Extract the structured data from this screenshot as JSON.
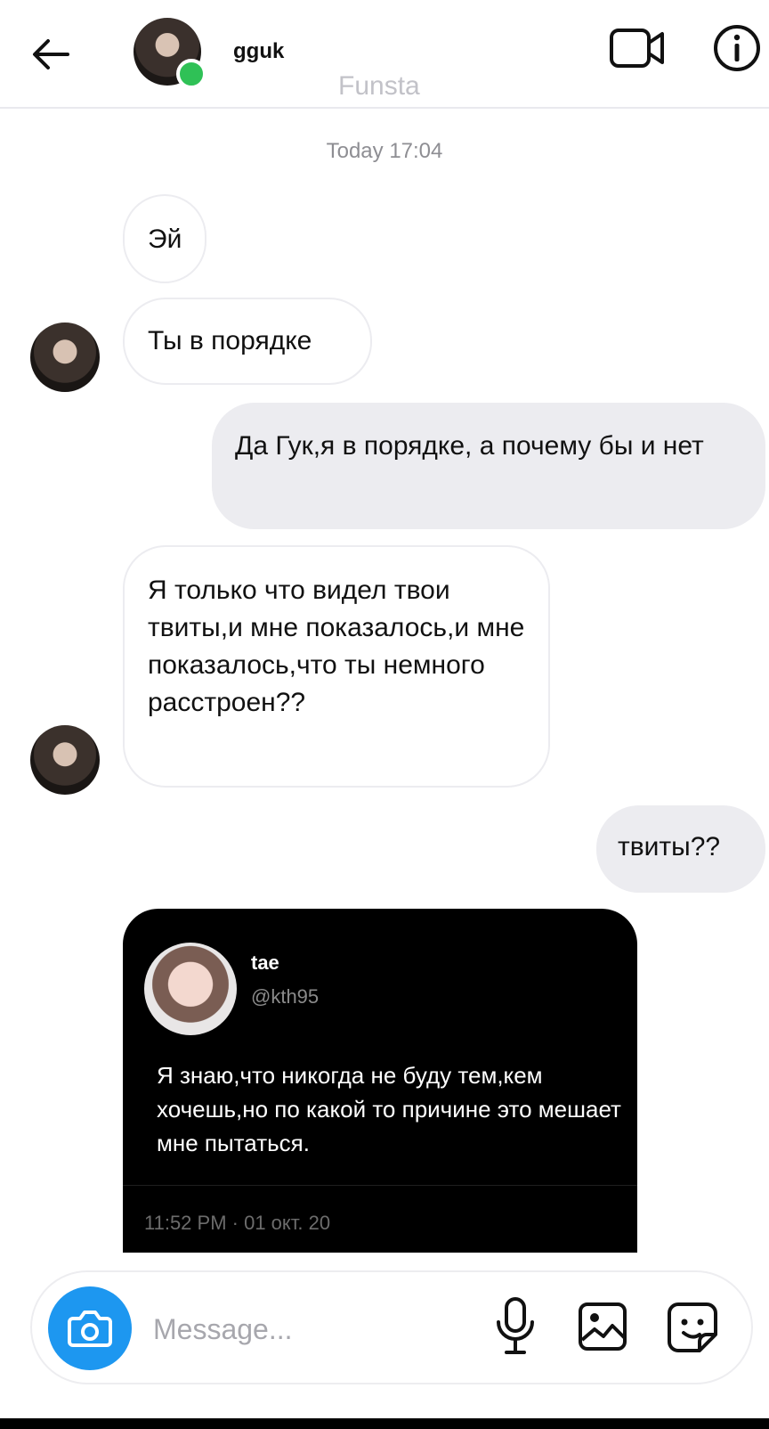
{
  "header": {
    "username": "gguk",
    "subtitle": "Funsta",
    "back_icon": "arrow-left-icon",
    "video_icon": "video-camera-icon",
    "info_icon": "info-icon",
    "online_color": "#2fc156"
  },
  "chat": {
    "timestamp": "Today 17:04",
    "messages": [
      {
        "from": "them",
        "text": "Эй"
      },
      {
        "from": "them",
        "text": "Ты в порядке"
      },
      {
        "from": "me",
        "text": "Да Гук,я в порядке, а почему бы и нет"
      },
      {
        "from": "them",
        "text": "Я только что видел твои твиты,и мне показалось,и мне показалось,что ты немного расстроен??"
      },
      {
        "from": "me",
        "text": "твиты??"
      }
    ],
    "tweet": {
      "name": "tae",
      "handle": "@kth95",
      "text": "Я знаю,что никогда не буду тем,кем хочешь,но по какой то причине это мешает мне пытаться.",
      "time": "11:52 PM · 01 окт. 20"
    }
  },
  "composer": {
    "placeholder": "Message...",
    "camera_icon": "camera-icon",
    "mic_icon": "microphone-icon",
    "gallery_icon": "image-icon",
    "sticker_icon": "sticker-icon",
    "accent_color": "#1d97f0"
  }
}
